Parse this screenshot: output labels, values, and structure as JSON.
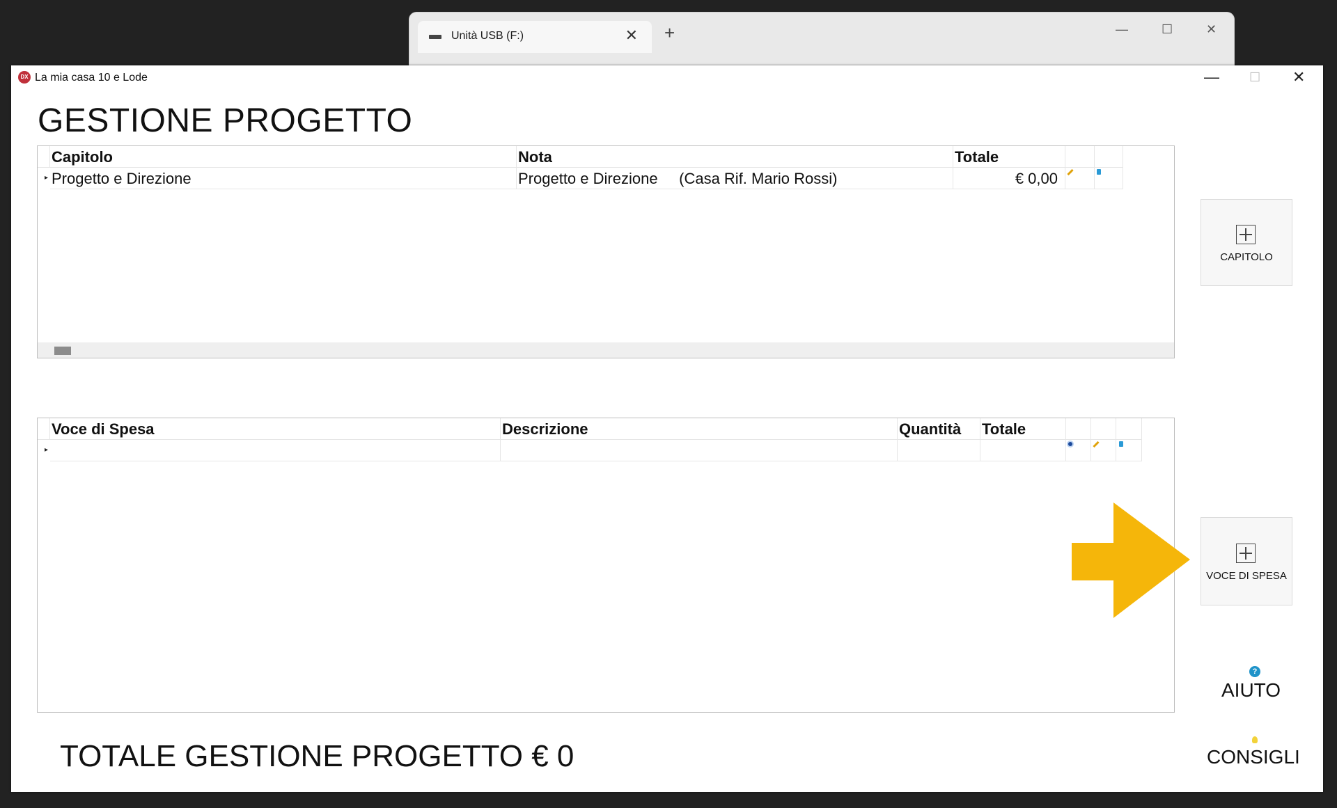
{
  "background_window": {
    "tab_label": "Unità USB (F:)",
    "close_glyph": "✕",
    "new_tab_glyph": "+",
    "minimize_glyph": "—",
    "maximize_glyph": "☐",
    "window_close_glyph": "✕"
  },
  "app": {
    "logo_text": "DX",
    "title": "La mia casa 10 e Lode",
    "minimize_glyph": "—",
    "maximize_glyph": "☐",
    "close_glyph": "✕",
    "page_title": "GESTIONE PROGETTO"
  },
  "chapters_grid": {
    "headers": {
      "capitolo": "Capitolo",
      "nota": "Nota",
      "totale": "Totale"
    },
    "rows": [
      {
        "indicator": "▸",
        "capitolo": "Progetto e Direzione",
        "nota": "Progetto e Direzione     (Casa Rif. Mario Rossi)",
        "totale": "€ 0,00"
      }
    ]
  },
  "items_grid": {
    "headers": {
      "voce": "Voce di Spesa",
      "descrizione": "Descrizione",
      "quantita": "Quantità",
      "totale": "Totale"
    },
    "rows": [
      {
        "indicator": "▸",
        "voce": "",
        "descrizione": "",
        "quantita": "",
        "totale": ""
      }
    ]
  },
  "side_buttons": {
    "capitolo_label": "CAPITOLO",
    "voce_label": "VOCE DI SPESA",
    "aiuto_label": "AIUTO",
    "aiuto_icon_text": "?",
    "consigli_label": "CONSIGLI"
  },
  "footer": {
    "total_text": "TOTALE GESTIONE PROGETTO € 0"
  },
  "colors": {
    "arrow": "#f5b60a",
    "pencil": "#e0a20a",
    "trash": "#2a9ad6",
    "help": "#1f93c9"
  },
  "icons": [
    "drive-icon",
    "app-logo-icon",
    "pencil-icon",
    "trash-icon",
    "eye-icon",
    "plus-icon",
    "help-icon",
    "bulb-icon",
    "arrow-right-icon"
  ]
}
